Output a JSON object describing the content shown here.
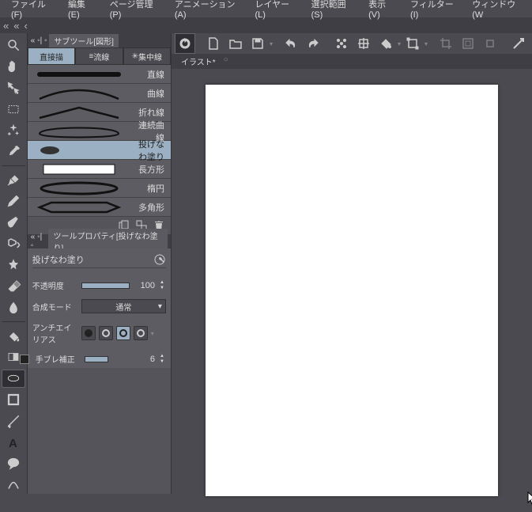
{
  "menu": {
    "file": "ファイル(F)",
    "edit": "編集(E)",
    "page": "ページ管理(P)",
    "anim": "アニメーション(A)",
    "layer": "レイヤー(L)",
    "sel": "選択範囲(S)",
    "view": "表示(V)",
    "filter": "フィルター(I)",
    "window": "ウィンドウ(W"
  },
  "subtool_tab": "サブツール[図形]",
  "mode": {
    "direct": "直接描",
    "stream": "流線",
    "conc": "集中線"
  },
  "subtools": [
    {
      "name": "直線"
    },
    {
      "name": "曲線"
    },
    {
      "name": "折れ線"
    },
    {
      "name": "連続曲線"
    },
    {
      "name": "投げなわ塗り"
    },
    {
      "name": "長方形"
    },
    {
      "name": "楕円"
    },
    {
      "name": "多角形"
    }
  ],
  "prop_tab": "ツールプロパティ[投げなわ塗り]",
  "prop_title": "投げなわ塗り",
  "prop": {
    "opacity_label": "不透明度",
    "opacity_value": "100",
    "blend_label": "合成モード",
    "blend_value": "通常",
    "aa_label": "アンチエイリアス",
    "shake_label": "手ブレ補正",
    "shake_value": "6"
  },
  "doc_tab": "イラスト*"
}
